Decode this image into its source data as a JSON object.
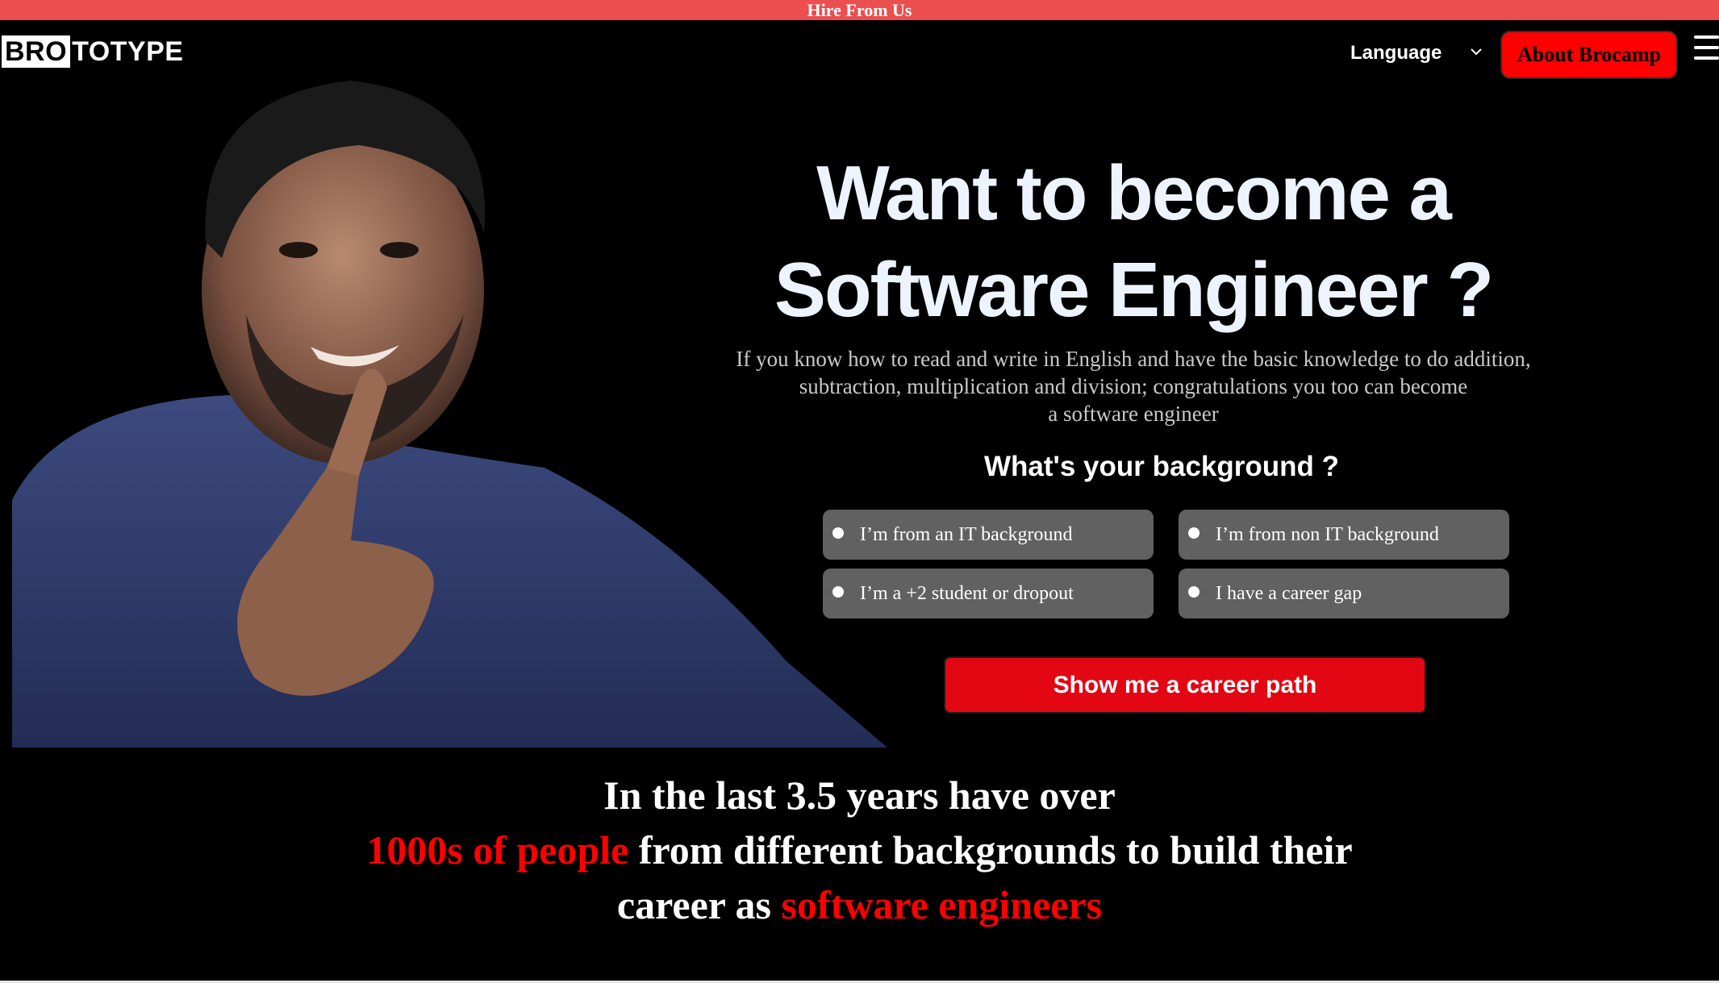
{
  "topbar": {
    "label": "Hire From Us"
  },
  "header": {
    "logo_box": "BRO",
    "logo_rest": "TOTYPE",
    "language_label": "Language",
    "about_button": "About Brocamp"
  },
  "hero": {
    "headline_line1": "Want to become a",
    "headline_line2": "Software Engineer ?",
    "subtext_line1": "If you know how to read and write in English and have the basic knowledge to do addition,",
    "subtext_line2": "subtraction, multiplication and division; congratulations you too can become",
    "subtext_line3": "a software engineer",
    "question": "What's your background ?",
    "options": [
      {
        "label": "I’m from an IT background"
      },
      {
        "label": "I’m from non IT background"
      },
      {
        "label": "I’m a +2 student or dropout"
      },
      {
        "label": "I have a career gap"
      }
    ],
    "cta": "Show me a career path"
  },
  "stats": {
    "line1": "In the last 3.5 years have over",
    "line2_red": "1000s of people",
    "line2_white": " from different backgrounds to build their",
    "line3_white": "career as ",
    "line3_red": "software engineers"
  },
  "colors": {
    "topbar": "#ea4e4f",
    "accent_red": "#ff0000",
    "cta_red": "#e30613",
    "option_bg": "#616161"
  },
  "icons": [
    "chevron-down-icon",
    "hamburger-menu-icon",
    "radio-icon"
  ]
}
